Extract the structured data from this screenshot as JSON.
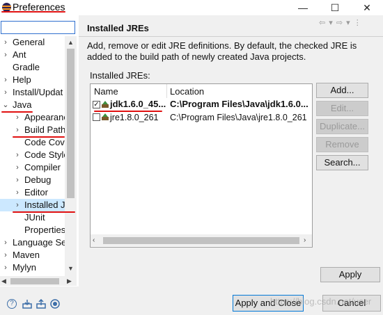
{
  "window": {
    "title": "Preferences",
    "minimize_glyph": "—",
    "maximize_glyph": "☐",
    "close_glyph": "✕"
  },
  "filter": {
    "value": "",
    "placeholder": ""
  },
  "tree": {
    "items": [
      {
        "label": "General",
        "chevron": "›"
      },
      {
        "label": "Ant",
        "chevron": "›"
      },
      {
        "label": "Gradle",
        "chevron": ""
      },
      {
        "label": "Help",
        "chevron": "›"
      },
      {
        "label": "Install/Updat",
        "chevron": "›"
      },
      {
        "label": "Java",
        "chevron": "⌄"
      },
      {
        "label": "Appearanc",
        "chevron": "›"
      },
      {
        "label": "Build Path",
        "chevron": "›"
      },
      {
        "label": "Code Cove",
        "chevron": ""
      },
      {
        "label": "Code Style",
        "chevron": "›"
      },
      {
        "label": "Compiler",
        "chevron": "›"
      },
      {
        "label": "Debug",
        "chevron": "›"
      },
      {
        "label": "Editor",
        "chevron": "›"
      },
      {
        "label": "Installed J",
        "chevron": "›"
      },
      {
        "label": "JUnit",
        "chevron": ""
      },
      {
        "label": "Properties",
        "chevron": ""
      },
      {
        "label": "Language Se",
        "chevron": "›"
      },
      {
        "label": "Maven",
        "chevron": "›"
      },
      {
        "label": "Mylyn",
        "chevron": "›"
      }
    ],
    "selected": "Installed J"
  },
  "page": {
    "title": "Installed JREs",
    "nav_arrows": "⇦ ▾ ⇨ ▾ ⋮",
    "description": "Add, remove or edit JRE definitions. By default, the checked JRE is added to the build path of newly created Java projects.",
    "list_label": "Installed JREs:"
  },
  "table": {
    "columns": [
      "Name",
      "Location"
    ],
    "rows": [
      {
        "name": "jdk1.6.0_45...",
        "location": "C:\\Program Files\\Java\\jdk1.6.0...",
        "checked": true,
        "bold": true
      },
      {
        "name": "jre1.8.0_261",
        "location": "C:\\Program Files\\Java\\jre1.8.0_261",
        "checked": false,
        "bold": false
      }
    ]
  },
  "buttons": {
    "add": "Add...",
    "edit": "Edit...",
    "duplicate": "Duplicate...",
    "remove": "Remove",
    "search": "Search...",
    "apply": "Apply",
    "apply_close": "Apply and Close",
    "cancel": "Cancel"
  },
  "bottom_icons": [
    "help-icon",
    "import-icon",
    "export-icon",
    "oomph-icon"
  ],
  "watermark": "https://blog.csdn.net/user",
  "colors": {
    "annotation_red": "#e01010",
    "focus_blue": "#0078d7"
  }
}
